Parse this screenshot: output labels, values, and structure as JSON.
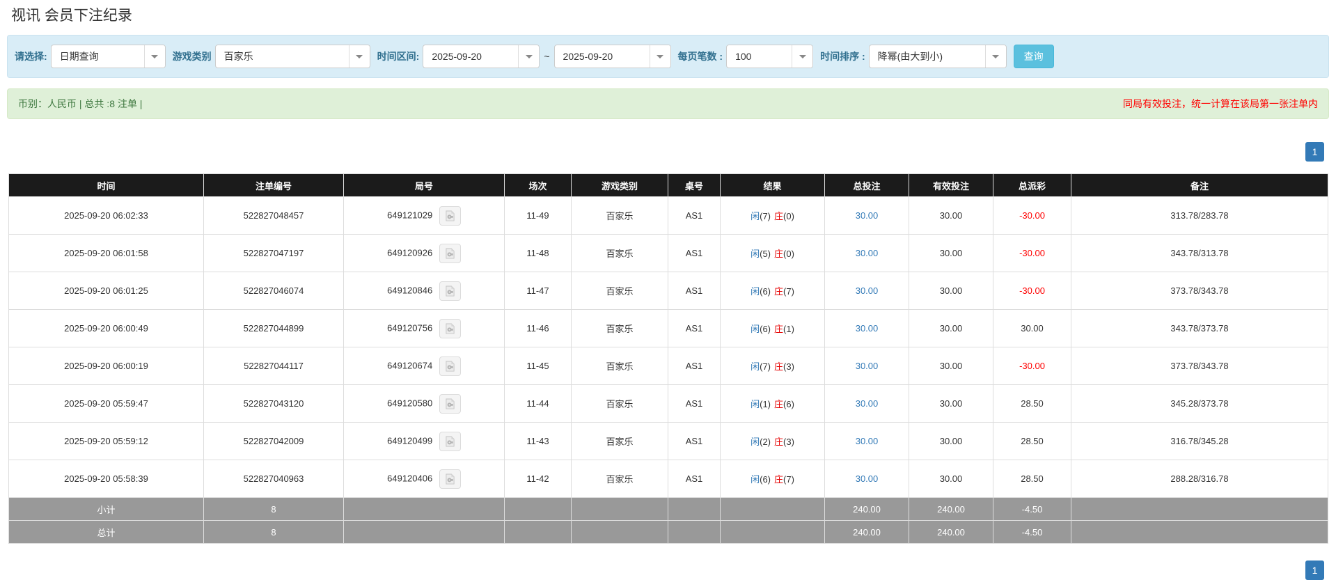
{
  "page": {
    "title": "视讯 会员下注纪录"
  },
  "colors": {
    "accent_button": "#5bc0de",
    "pagination_active": "#337ab7",
    "link_blue": "#337ab7",
    "result_player_blue": "#337ab7",
    "result_banker_red": "#e60000",
    "negative_red": "#ff0000",
    "info_bar_green_bg": "#dff0d8",
    "info_bar_green_text": "#3c763d",
    "filter_bar_bg": "#d9edf7",
    "header_black": "#1b1b1b",
    "summary_gray": "#999999"
  },
  "filters": {
    "select_label": "请选择:",
    "select_value": "日期查询",
    "game_label": "游戏类别",
    "game_value": "百家乐",
    "range_label": "时间区间:",
    "date_from": "2025-09-20",
    "range_sep": "~",
    "date_to": "2025-09-20",
    "per_page_label": "每页笔数 :",
    "per_page_value": "100",
    "sort_label": "时间排序 :",
    "sort_value": "降幂(由大到小)",
    "search_button": "查询"
  },
  "info_bar": {
    "summary": "币别：人民币 | 总共 :8 注单 |",
    "notice": "同局有效投注，统一计算在该局第一张注单内"
  },
  "pagination": {
    "current_page": "1"
  },
  "table": {
    "headers": [
      "时间",
      "注单编号",
      "局号",
      "场次",
      "游戏类别",
      "桌号",
      "结果",
      "总投注",
      "有效投注",
      "总派彩",
      "备注"
    ],
    "rows": [
      {
        "time": "2025-09-20 06:02:33",
        "bet_id": "522827048457",
        "round_id": "649121029",
        "session": "11-49",
        "game": "百家乐",
        "table_no": "AS1",
        "result": {
          "player_label": "闲",
          "player_score": "(7)",
          "banker_label": "庄",
          "banker_score": "(0)"
        },
        "total_bet": "30.00",
        "valid_bet": "30.00",
        "payout": "-30.00",
        "remark": "313.78/283.78"
      },
      {
        "time": "2025-09-20 06:01:58",
        "bet_id": "522827047197",
        "round_id": "649120926",
        "session": "11-48",
        "game": "百家乐",
        "table_no": "AS1",
        "result": {
          "player_label": "闲",
          "player_score": "(5)",
          "banker_label": "庄",
          "banker_score": "(0)"
        },
        "total_bet": "30.00",
        "valid_bet": "30.00",
        "payout": "-30.00",
        "remark": "343.78/313.78"
      },
      {
        "time": "2025-09-20 06:01:25",
        "bet_id": "522827046074",
        "round_id": "649120846",
        "session": "11-47",
        "game": "百家乐",
        "table_no": "AS1",
        "result": {
          "player_label": "闲",
          "player_score": "(6)",
          "banker_label": "庄",
          "banker_score": "(7)"
        },
        "total_bet": "30.00",
        "valid_bet": "30.00",
        "payout": "-30.00",
        "remark": "373.78/343.78"
      },
      {
        "time": "2025-09-20 06:00:49",
        "bet_id": "522827044899",
        "round_id": "649120756",
        "session": "11-46",
        "game": "百家乐",
        "table_no": "AS1",
        "result": {
          "player_label": "闲",
          "player_score": "(6)",
          "banker_label": "庄",
          "banker_score": "(1)"
        },
        "total_bet": "30.00",
        "valid_bet": "30.00",
        "payout": "30.00",
        "remark": "343.78/373.78"
      },
      {
        "time": "2025-09-20 06:00:19",
        "bet_id": "522827044117",
        "round_id": "649120674",
        "session": "11-45",
        "game": "百家乐",
        "table_no": "AS1",
        "result": {
          "player_label": "闲",
          "player_score": "(7)",
          "banker_label": "庄",
          "banker_score": "(3)"
        },
        "total_bet": "30.00",
        "valid_bet": "30.00",
        "payout": "-30.00",
        "remark": "373.78/343.78"
      },
      {
        "time": "2025-09-20 05:59:47",
        "bet_id": "522827043120",
        "round_id": "649120580",
        "session": "11-44",
        "game": "百家乐",
        "table_no": "AS1",
        "result": {
          "player_label": "闲",
          "player_score": "(1)",
          "banker_label": "庄",
          "banker_score": "(6)"
        },
        "total_bet": "30.00",
        "valid_bet": "30.00",
        "payout": "28.50",
        "remark": "345.28/373.78"
      },
      {
        "time": "2025-09-20 05:59:12",
        "bet_id": "522827042009",
        "round_id": "649120499",
        "session": "11-43",
        "game": "百家乐",
        "table_no": "AS1",
        "result": {
          "player_label": "闲",
          "player_score": "(2)",
          "banker_label": "庄",
          "banker_score": "(3)"
        },
        "total_bet": "30.00",
        "valid_bet": "30.00",
        "payout": "28.50",
        "remark": "316.78/345.28"
      },
      {
        "time": "2025-09-20 05:58:39",
        "bet_id": "522827040963",
        "round_id": "649120406",
        "session": "11-42",
        "game": "百家乐",
        "table_no": "AS1",
        "result": {
          "player_label": "闲",
          "player_score": "(6)",
          "banker_label": "庄",
          "banker_score": "(7)"
        },
        "total_bet": "30.00",
        "valid_bet": "30.00",
        "payout": "28.50",
        "remark": "288.28/316.78"
      }
    ],
    "summary_rows": [
      {
        "label": "小计",
        "count": "8",
        "total_bet": "240.00",
        "valid_bet": "240.00",
        "payout": "-4.50"
      },
      {
        "label": "总计",
        "count": "8",
        "total_bet": "240.00",
        "valid_bet": "240.00",
        "payout": "-4.50"
      }
    ]
  }
}
